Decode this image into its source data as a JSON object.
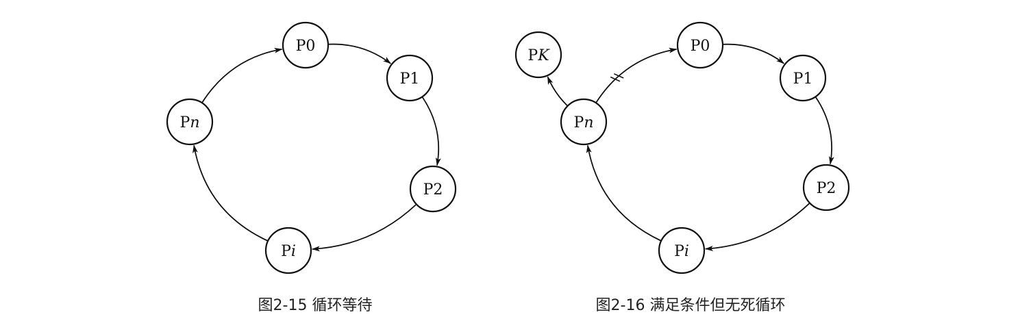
{
  "figures": [
    {
      "id": "fig-2-15",
      "caption": "图2-15  循环等待",
      "nodes": [
        {
          "id": "p0",
          "base": "P",
          "sub": "0",
          "italic": false
        },
        {
          "id": "p1",
          "base": "P",
          "sub": "1",
          "italic": false
        },
        {
          "id": "p2",
          "base": "P",
          "sub": "2",
          "italic": false
        },
        {
          "id": "pi",
          "base": "P",
          "sub": "i",
          "italic": true
        },
        {
          "id": "pn",
          "base": "P",
          "sub": "n",
          "italic": true
        }
      ],
      "edges": [
        {
          "from": "p0",
          "to": "p1",
          "blocked": false
        },
        {
          "from": "p1",
          "to": "p2",
          "blocked": false
        },
        {
          "from": "p2",
          "to": "pi",
          "blocked": false
        },
        {
          "from": "pi",
          "to": "pn",
          "blocked": false
        },
        {
          "from": "pn",
          "to": "p0",
          "blocked": false
        }
      ]
    },
    {
      "id": "fig-2-16",
      "caption": "图2-16  满足条件但无死循环",
      "nodes": [
        {
          "id": "p0",
          "base": "P",
          "sub": "0",
          "italic": false
        },
        {
          "id": "p1",
          "base": "P",
          "sub": "1",
          "italic": false
        },
        {
          "id": "p2",
          "base": "P",
          "sub": "2",
          "italic": false
        },
        {
          "id": "pi",
          "base": "P",
          "sub": "i",
          "italic": true
        },
        {
          "id": "pn",
          "base": "P",
          "sub": "n",
          "italic": true
        },
        {
          "id": "pk",
          "base": "P",
          "sub": "K",
          "italic": true
        }
      ],
      "edges": [
        {
          "from": "p0",
          "to": "p1",
          "blocked": false
        },
        {
          "from": "p1",
          "to": "p2",
          "blocked": false
        },
        {
          "from": "p2",
          "to": "pi",
          "blocked": false
        },
        {
          "from": "pi",
          "to": "pn",
          "blocked": false
        },
        {
          "from": "pn",
          "to": "p0",
          "blocked": true
        },
        {
          "from": "pn",
          "to": "pk",
          "blocked": false
        }
      ]
    }
  ]
}
